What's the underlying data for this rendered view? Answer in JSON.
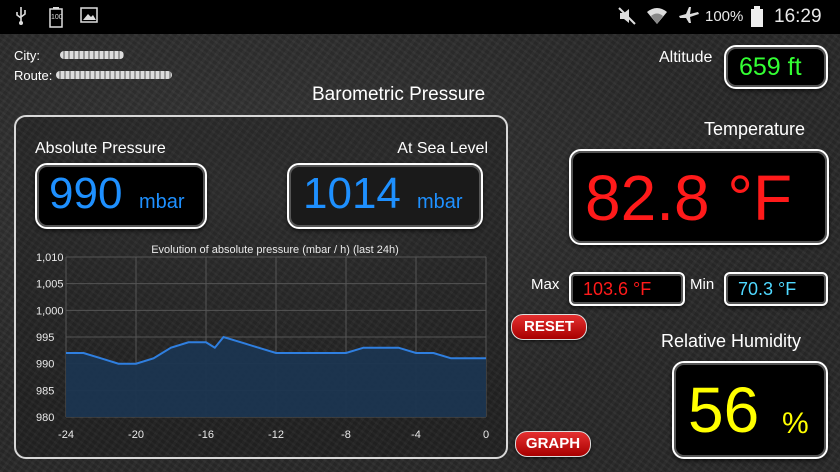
{
  "status_bar": {
    "battery_text": "100%",
    "time": "16:29",
    "icons": [
      "usb-icon",
      "battery-notification-icon",
      "image-icon",
      "mute-icon",
      "wifi-icon",
      "airplane-icon",
      "battery-icon"
    ],
    "notification_battery_label": "100"
  },
  "location": {
    "city_label": "City:",
    "route_label": "Route:"
  },
  "altitude": {
    "label": "Altitude",
    "value": "659 ft"
  },
  "pressure": {
    "title": "Barometric Pressure",
    "absolute_label": "Absolute Pressure",
    "absolute_value": "990",
    "absolute_unit": "mbar",
    "sea_level_label": "At Sea Level",
    "sea_level_value": "1014",
    "sea_level_unit": "mbar"
  },
  "temperature": {
    "label": "Temperature",
    "value": "82.8 °F",
    "max_label": "Max",
    "max_value": "103.6 °F",
    "min_label": "Min",
    "min_value": "70.3 °F"
  },
  "humidity": {
    "label": "Relative Humidity",
    "value": "56",
    "unit": "%"
  },
  "buttons": {
    "reset": "RESET",
    "graph": "GRAPH"
  },
  "colors": {
    "blue_value": "#1e90ff",
    "green_value": "#33ff33",
    "red_value": "#ff1a1a",
    "cyan_value": "#4fd8ff",
    "yellow_value": "#ffff00",
    "series_line": "#2f7fe0",
    "series_fill": "#1b3550"
  },
  "chart_data": {
    "type": "area",
    "title": "Evolution of absolute pressure (mbar / h) (last 24h)",
    "x": [
      -24,
      -23,
      -22,
      -21,
      -20,
      -19,
      -18,
      -17,
      -16,
      -15.5,
      -15,
      -14,
      -13,
      -12,
      -11,
      -10,
      -9,
      -8,
      -7,
      -6,
      -5,
      -4,
      -3,
      -2,
      -1,
      0
    ],
    "values": [
      992,
      992,
      991,
      990,
      990,
      991,
      993,
      994,
      994,
      993,
      995,
      994,
      993,
      992,
      992,
      992,
      992,
      992,
      993,
      993,
      993,
      992,
      992,
      991,
      991,
      991
    ],
    "x_ticks": [
      "-24",
      "-20",
      "-16",
      "-12",
      "-8",
      "-4",
      "0"
    ],
    "x_tick_values": [
      -24,
      -20,
      -16,
      -12,
      -8,
      -4,
      0
    ],
    "y_ticks": [
      "980",
      "985",
      "990",
      "995",
      "1,000",
      "1,005",
      "1,010"
    ],
    "y_tick_values": [
      980,
      985,
      990,
      995,
      1000,
      1005,
      1010
    ],
    "xlim": [
      -24,
      0
    ],
    "ylim": [
      980,
      1010
    ],
    "grid": true
  }
}
